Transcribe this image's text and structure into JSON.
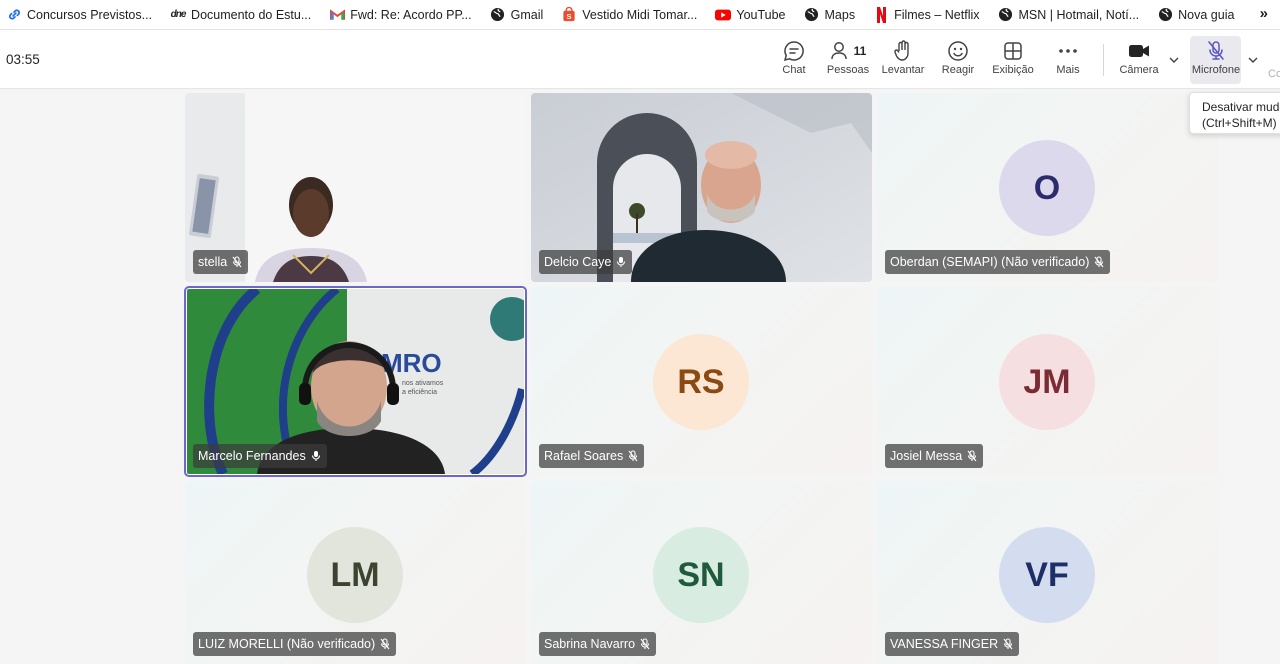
{
  "bookmarks": [
    {
      "label": "Concursos Previstos...",
      "icon": "link-icon",
      "color": "#1a73e8"
    },
    {
      "label": "Documento do Estu...",
      "icon": "dne-icon",
      "color": "#111111"
    },
    {
      "label": "Fwd: Re: Acordo PP...",
      "icon": "gmail-icon",
      "color": "#ea4335"
    },
    {
      "label": "Gmail",
      "icon": "globe-icon",
      "color": "#202124"
    },
    {
      "label": "Vestido Midi Tomar...",
      "icon": "shop-icon",
      "color": "#ee4d2d"
    },
    {
      "label": "YouTube",
      "icon": "youtube-icon",
      "color": "#ff0000"
    },
    {
      "label": "Maps",
      "icon": "globe-icon",
      "color": "#202124"
    },
    {
      "label": "Filmes – Netflix",
      "icon": "netflix-icon",
      "color": "#e50914"
    },
    {
      "label": "MSN | Hotmail, Notí...",
      "icon": "globe-icon",
      "color": "#202124"
    },
    {
      "label": "Nova guia",
      "icon": "globe-icon",
      "color": "#202124"
    }
  ],
  "bookmarks_more": "»",
  "meeting": {
    "timer": "03:55",
    "toolbar": {
      "chat": "Chat",
      "people": "Pessoas",
      "people_count": "11",
      "raise": "Levantar",
      "react": "Reagir",
      "view": "Exibição",
      "more": "Mais",
      "camera": "Câmera",
      "microphone": "Microfone",
      "cut_label": "Co"
    },
    "tooltip": {
      "line1": "Desativar mudo",
      "line2": "(Ctrl+Shift+M)"
    }
  },
  "participants": [
    {
      "name": "stella",
      "type": "video"
    },
    {
      "name": "Delcio Caye",
      "type": "video"
    },
    {
      "name": "Oberdan (SEMAPI) (Não verificado)",
      "type": "avatar",
      "initials": "O",
      "bg": "#ddd9ec",
      "fg": "#2b2b6e"
    },
    {
      "name": "Marcelo Fernandes",
      "type": "video",
      "speaking": true,
      "sign_text": "MRO",
      "sign_sub1": "nos ativamos",
      "sign_sub2": "a eficiência"
    },
    {
      "name": "Rafael Soares",
      "type": "avatar",
      "initials": "RS",
      "bg": "#fbe7d4",
      "fg": "#8a4a12"
    },
    {
      "name": "Josiel Messa",
      "type": "avatar",
      "initials": "JM",
      "bg": "#f6dfe1",
      "fg": "#7a2b34"
    },
    {
      "name": "LUIZ MORELLI (Não verificado)",
      "type": "avatar",
      "initials": "LM",
      "bg": "#e2e5dc",
      "fg": "#3c4330"
    },
    {
      "name": "Sabrina Navarro",
      "type": "avatar",
      "initials": "SN",
      "bg": "#d8ece2",
      "fg": "#1f5a3a"
    },
    {
      "name": "VANESSA FINGER",
      "type": "avatar",
      "initials": "VF",
      "bg": "#d4dcf0",
      "fg": "#1e2f66"
    }
  ]
}
